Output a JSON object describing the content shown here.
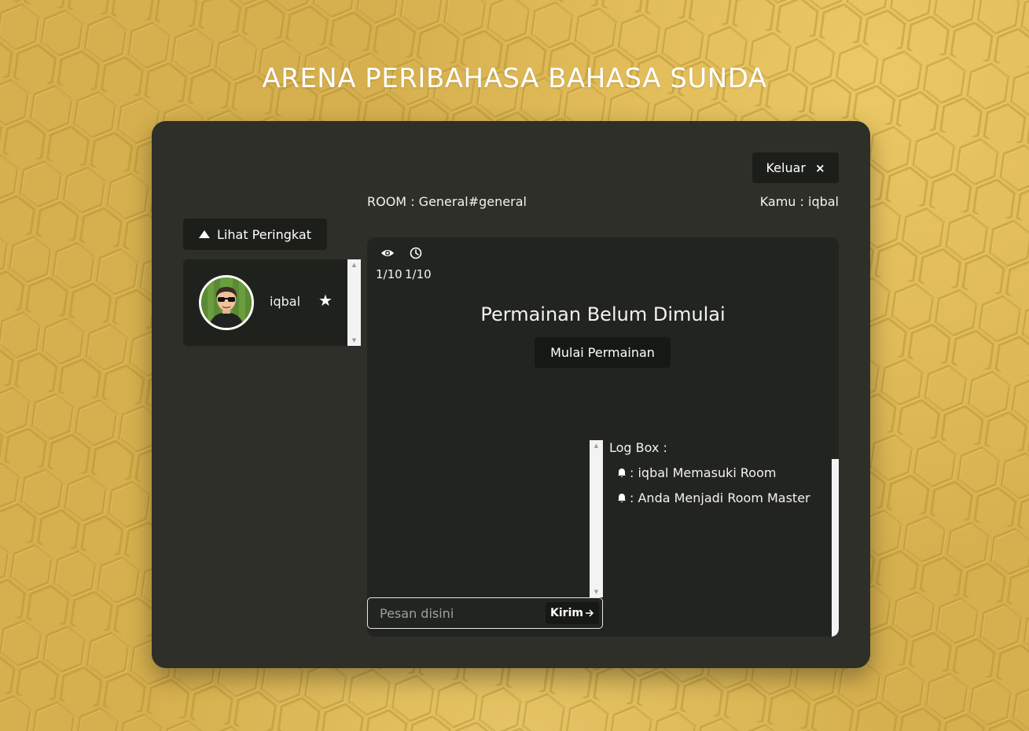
{
  "title": "ARENA PERIBAHASA BAHASA SUNDA",
  "header": {
    "exit_label": "Keluar",
    "exit_icon": "×",
    "room_label": "ROOM : General#general",
    "user_label": "Kamu : iqbal"
  },
  "sidebar": {
    "rank_button_label": "Lihat Peringkat",
    "players": [
      {
        "name": "iqbal",
        "is_room_master": true
      }
    ]
  },
  "game": {
    "views_count": "1/10",
    "time_count": "1/10",
    "status": "Permainan Belum Dimulai",
    "start_button_label": "Mulai Permainan"
  },
  "chat": {
    "placeholder": "Pesan disini",
    "send_label": "Kirim"
  },
  "log": {
    "title": "Log Box :",
    "entries": [
      ": iqbal Memasuki Room",
      ": Anda Menjadi Room Master"
    ]
  },
  "colors": {
    "background": "#d6b04e",
    "panel": "#2d2f28",
    "game_area": "#22241f",
    "button": "#1c1e19",
    "text": "#ffffff"
  },
  "icons": [
    "eye-icon",
    "clock-icon",
    "star-icon",
    "bell-icon",
    "arrow-right-icon",
    "close-icon",
    "triangle-up-icon"
  ]
}
